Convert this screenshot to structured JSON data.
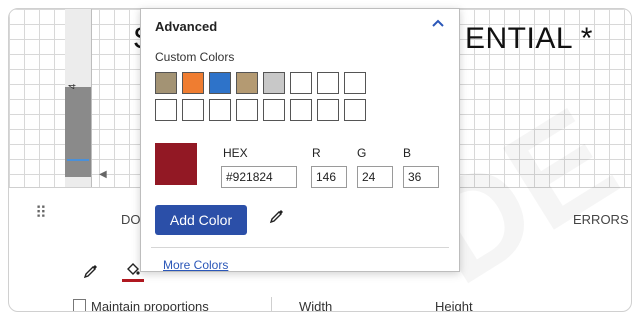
{
  "canvas": {
    "text_left": "S",
    "text_right": "ENTIAL *",
    "ruler_number": "4"
  },
  "toolbar": {
    "tab_doc": "DOC",
    "tab_errors": "ERRORS",
    "maintain_proportions": "Maintain proportions",
    "width_label": "Width",
    "height_label": "Height"
  },
  "popup": {
    "title": "Advanced",
    "custom_colors_label": "Custom Colors",
    "swatches": [
      "#a39374",
      "#ef7d31",
      "#2e73c9",
      "#b49a72",
      "#c8c8c8",
      "#ffffff",
      "#ffffff",
      "#ffffff",
      "#ffffff",
      "#ffffff",
      "#ffffff",
      "#ffffff",
      "#ffffff",
      "#ffffff",
      "#ffffff",
      "#ffffff"
    ],
    "preview_color": "#921824",
    "hex_label": "HEX",
    "r_label": "R",
    "g_label": "G",
    "b_label": "B",
    "hex_value": "#921824",
    "r_value": "146",
    "g_value": "24",
    "b_value": "36",
    "add_color_label": "Add Color",
    "more_colors_label": "More Colors"
  },
  "icons": {
    "collapse": "chevron-up-icon",
    "eyedropper": "eyedropper-icon",
    "fill": "paint-bucket-icon",
    "grip": "drag-handle-icon"
  },
  "colors": {
    "accent": "#2b4fa8",
    "link": "#2b57b8",
    "fill_color": "#b01820"
  }
}
